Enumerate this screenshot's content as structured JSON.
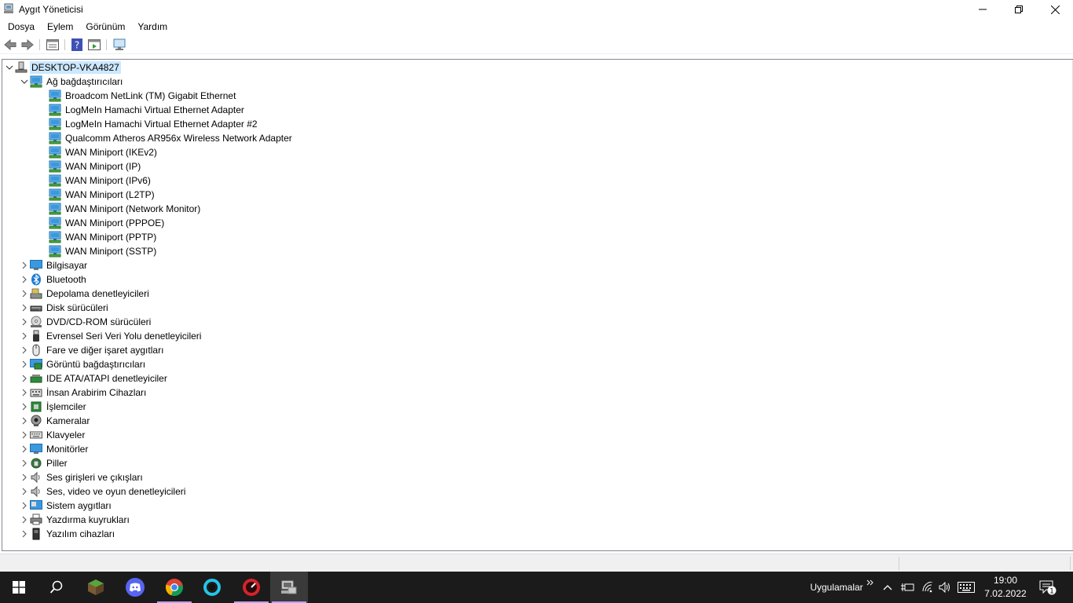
{
  "window": {
    "title": "Aygıt Yöneticisi",
    "minimize": "minimize",
    "maximize": "maximize",
    "close": "close"
  },
  "menu": [
    "Dosya",
    "Eylem",
    "Görünüm",
    "Yardım"
  ],
  "toolbar": [
    "back-arrow-icon",
    "forward-arrow-icon",
    "properties-icon",
    "help-icon",
    "update-driver-icon",
    "scan-hardware-icon"
  ],
  "tree": {
    "root": "DESKTOP-VKA4827",
    "expanded_category": "Ağ bağdaştırıcıları",
    "network_adapters": [
      "Broadcom NetLink (TM) Gigabit Ethernet",
      "LogMeIn Hamachi Virtual Ethernet Adapter",
      "LogMeIn Hamachi Virtual Ethernet Adapter #2",
      "Qualcomm Atheros AR956x Wireless Network Adapter",
      "WAN Miniport (IKEv2)",
      "WAN Miniport (IP)",
      "WAN Miniport (IPv6)",
      "WAN Miniport (L2TP)",
      "WAN Miniport (Network Monitor)",
      "WAN Miniport (PPPOE)",
      "WAN Miniport (PPTP)",
      "WAN Miniport (SSTP)"
    ],
    "categories": [
      {
        "label": "Bilgisayar",
        "icon": "computer-icon"
      },
      {
        "label": "Bluetooth",
        "icon": "bluetooth-icon"
      },
      {
        "label": "Depolama denetleyicileri",
        "icon": "storage-controller-icon"
      },
      {
        "label": "Disk sürücüleri",
        "icon": "disk-drive-icon"
      },
      {
        "label": "DVD/CD-ROM sürücüleri",
        "icon": "dvd-icon"
      },
      {
        "label": "Evrensel Seri Veri Yolu denetleyicileri",
        "icon": "usb-icon"
      },
      {
        "label": "Fare ve diğer işaret aygıtları",
        "icon": "mouse-icon"
      },
      {
        "label": "Görüntü bağdaştırıcıları",
        "icon": "display-adapter-icon"
      },
      {
        "label": "IDE ATA/ATAPI denetleyiciler",
        "icon": "ide-icon"
      },
      {
        "label": "İnsan Arabirim Cihazları",
        "icon": "hid-icon"
      },
      {
        "label": "İşlemciler",
        "icon": "processor-icon"
      },
      {
        "label": "Kameralar",
        "icon": "camera-icon"
      },
      {
        "label": "Klavyeler",
        "icon": "keyboard-icon"
      },
      {
        "label": "Monitörler",
        "icon": "monitor-icon"
      },
      {
        "label": "Piller",
        "icon": "battery-icon"
      },
      {
        "label": "Ses girişleri ve çıkışları",
        "icon": "speaker-icon"
      },
      {
        "label": "Ses, video ve oyun denetleyicileri",
        "icon": "sound-controller-icon"
      },
      {
        "label": "Sistem aygıtları",
        "icon": "system-device-icon"
      },
      {
        "label": "Yazdırma kuyrukları",
        "icon": "printer-icon"
      },
      {
        "label": "Yazılım cihazları",
        "icon": "software-device-icon"
      }
    ]
  },
  "taskbar": {
    "apps": [
      "start-icon",
      "search-icon",
      "minecraft-icon",
      "discord-icon",
      "chrome-icon",
      "app-ring-icon",
      "speedometer-app-icon",
      "device-manager-icon"
    ],
    "tray_label": "Uygulamalar",
    "time": "19:00",
    "date": "7.02.2022",
    "notification_count": "1"
  },
  "colors": {
    "selection": "#cce8ff",
    "taskbar": "#1b1b1b",
    "active_underline": "#c39df6",
    "net_icon": "#2f8fd8"
  }
}
